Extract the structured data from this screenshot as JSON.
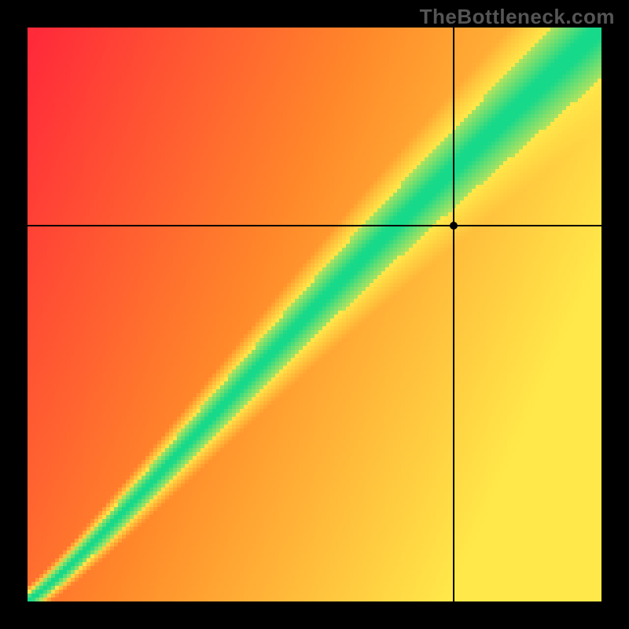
{
  "watermark": "TheBottleneck.com",
  "chart_data": {
    "type": "heatmap",
    "title": "",
    "xlabel": "",
    "ylabel": "",
    "xlim": [
      0,
      1
    ],
    "ylim": [
      0,
      1
    ],
    "resolution": 146,
    "diagonal": {
      "center_exponent": 1.18,
      "center_amp": 0.07,
      "green_halfwidth": 0.055,
      "yellow_halfwidth": 0.11
    },
    "crosshair": {
      "x": 0.742,
      "y": 0.655
    },
    "marker": {
      "x": 0.742,
      "y": 0.655
    },
    "colors": {
      "red": "#ff2a3a",
      "orange": "#ff8a2a",
      "yellow": "#ffe94a",
      "green": "#17d98a"
    }
  }
}
